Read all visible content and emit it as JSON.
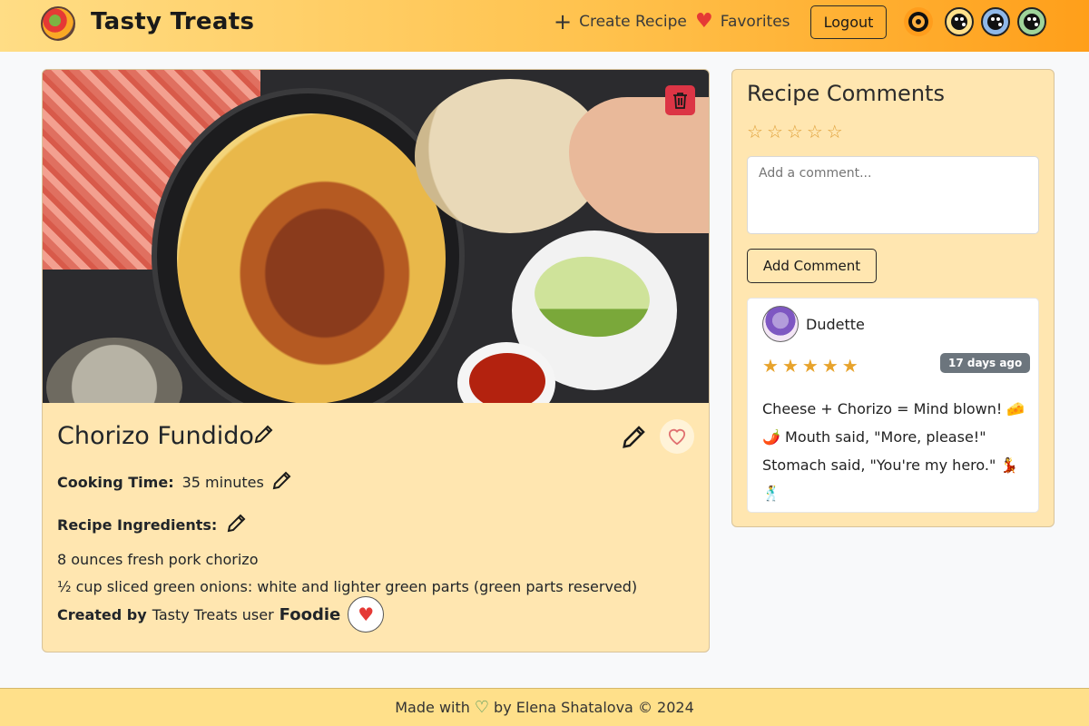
{
  "navbar": {
    "brand": "Tasty Treats",
    "create_recipe": "Create Recipe",
    "favorites": "Favorites",
    "logout": "Logout"
  },
  "recipe": {
    "title": "Chorizo Fundido",
    "cooking_time_label": "Cooking Time:",
    "cooking_time": "35 minutes",
    "ingredients_label": "Recipe Ingredients:",
    "ingredients": [
      "8 ounces fresh pork chorizo",
      "½ cup sliced green onions: white and lighter green parts (green parts reserved)"
    ],
    "created_by_label": "Created by",
    "created_by_mid": "Tasty Treats user",
    "creator": "Foodie"
  },
  "comments": {
    "title": "Recipe Comments",
    "placeholder": "Add a comment...",
    "add_button": "Add Comment",
    "items": [
      {
        "user": "Dudette",
        "rating": 5,
        "age": "17 days ago",
        "text": "Cheese + Chorizo = Mind blown! 🧀 🌶️ Mouth said, \"More, please!\" Stomach said, \"You're my hero.\" 💃 🕺"
      }
    ]
  },
  "footer": {
    "made_with": "Made with",
    "by": "by Elena Shatalova © 2024"
  },
  "colors": {
    "navbar_start": "#ffdd85",
    "navbar_end": "#ff9f1a",
    "card_bg": "#ffe6b0",
    "delete": "#dc3545",
    "star": "#e7a32c",
    "badge": "#6c757d"
  },
  "icons": [
    "plus-icon",
    "heart-icon",
    "palette-icon",
    "gear-icon",
    "trash-icon",
    "pencil-icon",
    "heart-outline-icon",
    "star-icon"
  ]
}
